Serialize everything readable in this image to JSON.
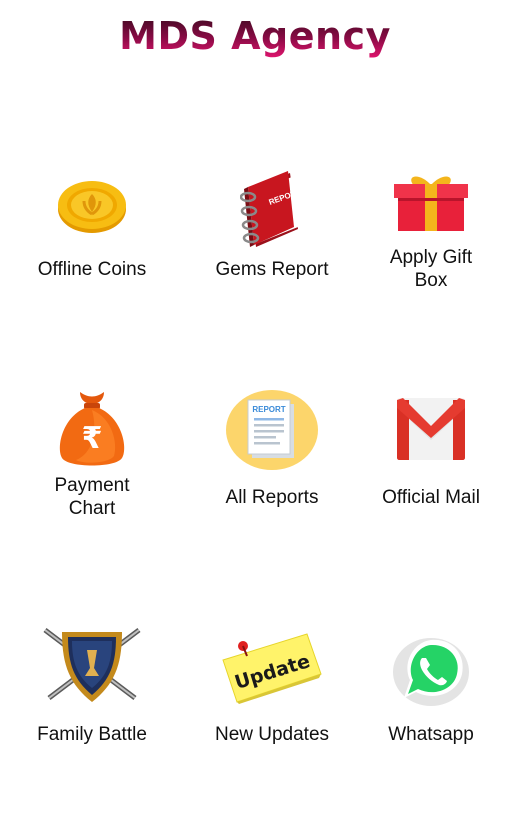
{
  "header": {
    "title": "MDS Agency"
  },
  "tiles": [
    {
      "label": "Offline Coins",
      "icon": "gold-coin-icon"
    },
    {
      "label": "Gems Report",
      "icon": "report-book-icon",
      "icon_text": "REPORT"
    },
    {
      "label": "Apply Gift\nBox",
      "icon": "gift-box-icon"
    },
    {
      "label": "Payment\nChart",
      "icon": "rupee-money-bag-icon",
      "icon_text": "₹"
    },
    {
      "label": "All Reports",
      "icon": "report-document-icon",
      "icon_text": "REPORT"
    },
    {
      "label": "Official Mail",
      "icon": "gmail-icon"
    },
    {
      "label": "Family Battle",
      "icon": "shield-swords-icon"
    },
    {
      "label": "New Updates",
      "icon": "update-note-icon",
      "icon_text": "Update"
    },
    {
      "label": "Whatsapp",
      "icon": "whatsapp-icon"
    }
  ],
  "colors": {
    "title_gradient": [
      "#3a0a1e",
      "#8a0b45",
      "#e0146e"
    ],
    "gold": "#f5b800",
    "gift_red": "#e8213a",
    "bag_orange": "#f26a12",
    "gmail_red": "#d93025",
    "whatsapp_green": "#25d366"
  }
}
